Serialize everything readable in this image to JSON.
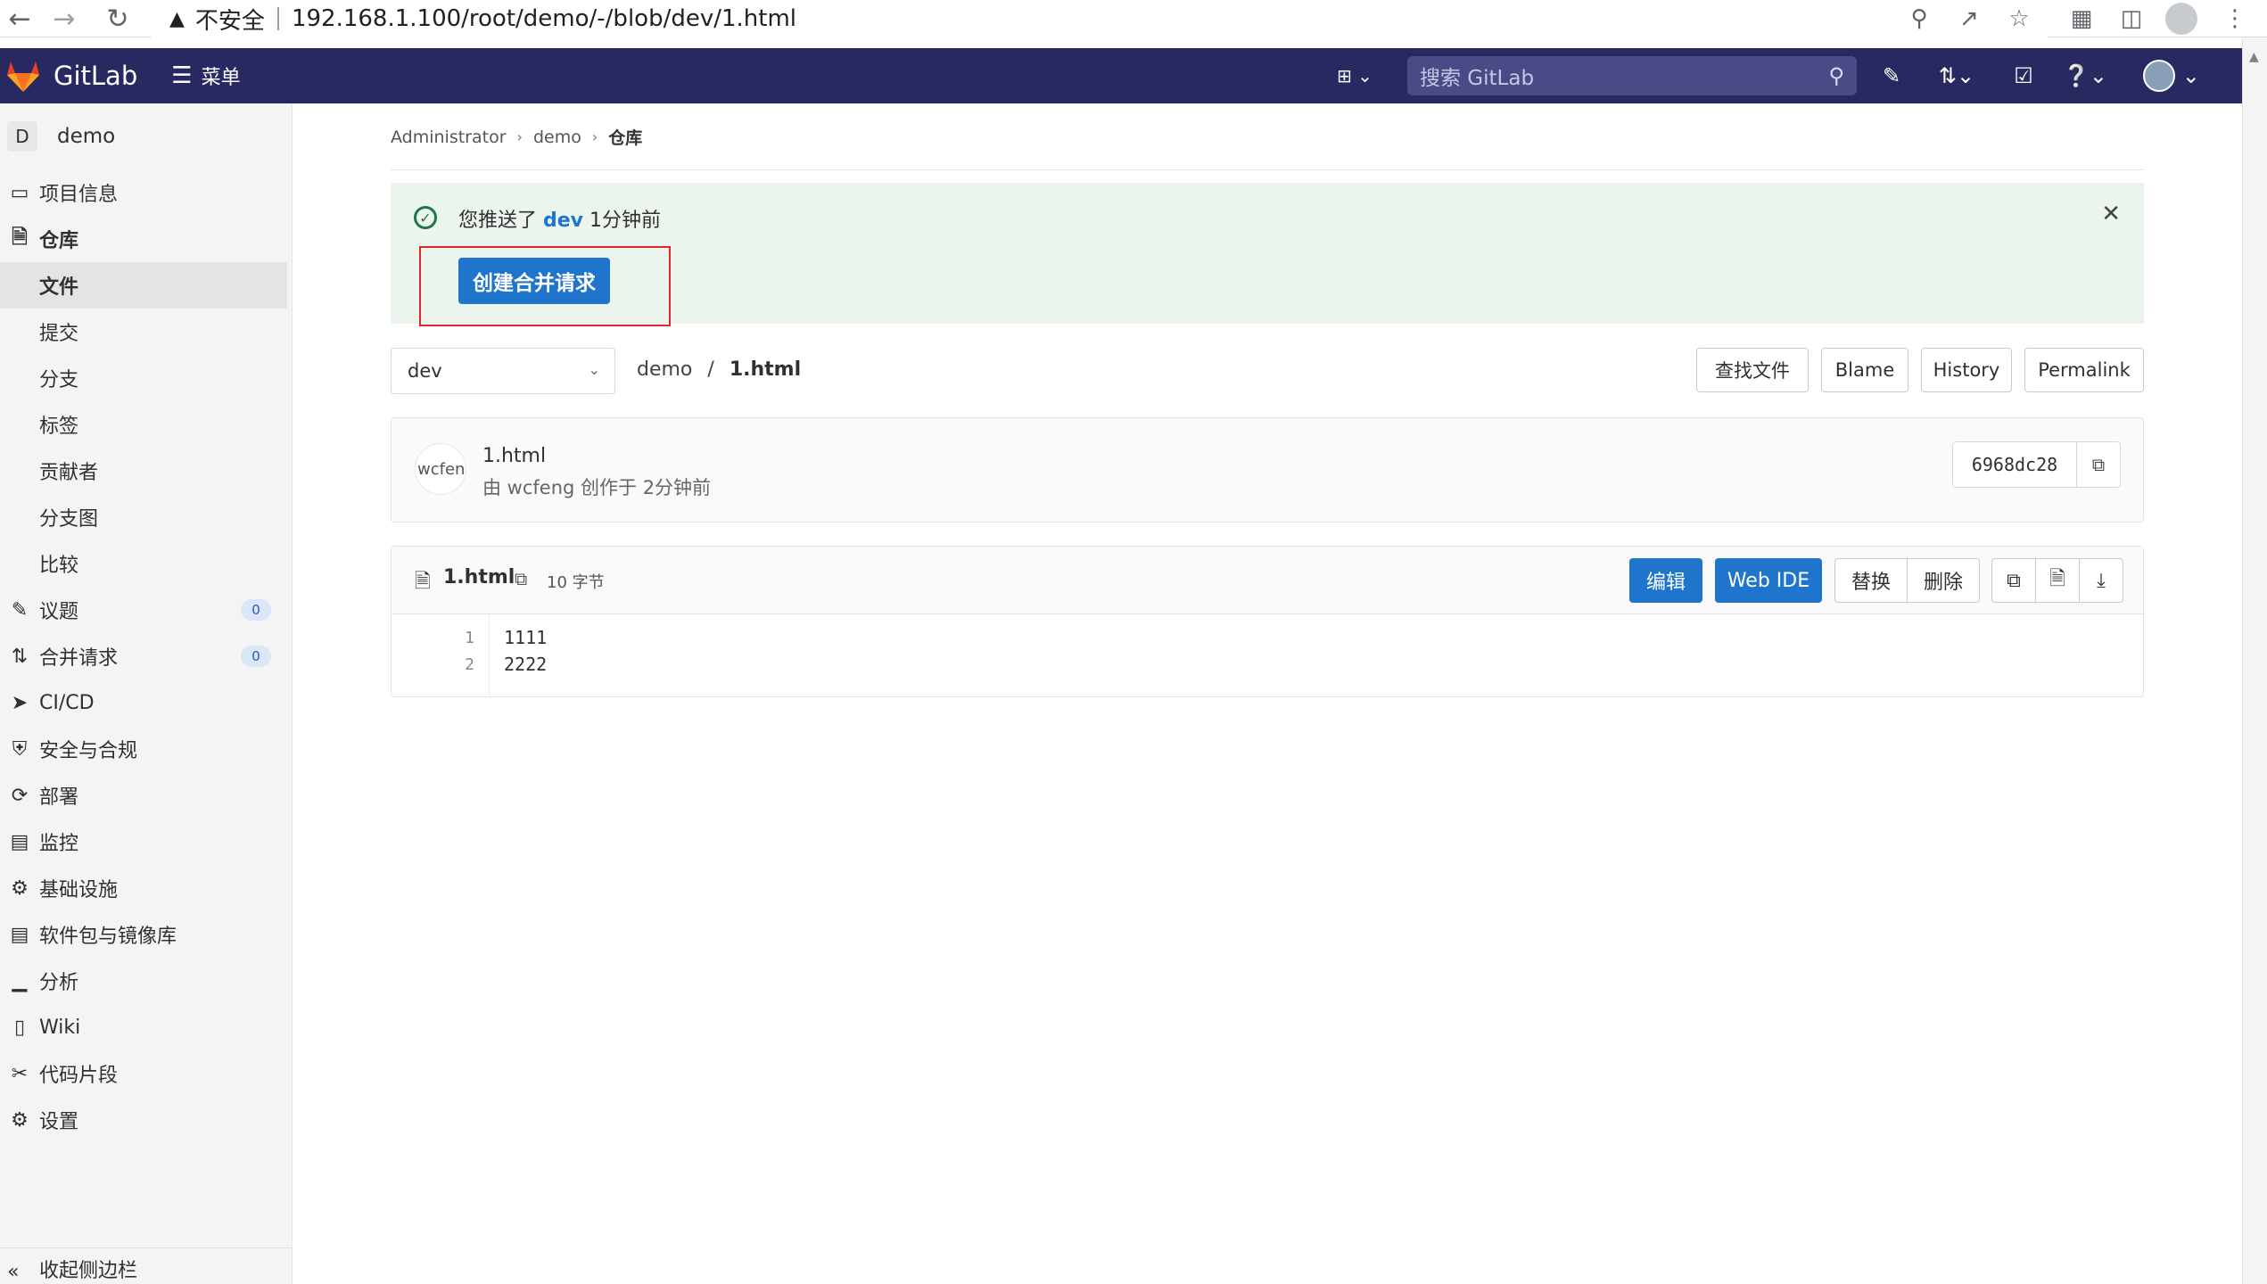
{
  "browser": {
    "security_label": "不安全",
    "url": "192.168.1.100/root/demo/-/blob/dev/1.html"
  },
  "topnav": {
    "app_name": "GitLab",
    "menu_label": "菜单",
    "search_placeholder": "搜索 GitLab"
  },
  "sidebar": {
    "project_initial": "D",
    "project_name": "demo",
    "items": [
      {
        "label": "项目信息",
        "icon": "info-icon"
      },
      {
        "label": "仓库",
        "icon": "repository-icon"
      },
      {
        "label": "文件"
      },
      {
        "label": "提交"
      },
      {
        "label": "分支"
      },
      {
        "label": "标签"
      },
      {
        "label": "贡献者"
      },
      {
        "label": "分支图"
      },
      {
        "label": "比较"
      },
      {
        "label": "议题",
        "icon": "issues-icon",
        "badge": "0"
      },
      {
        "label": "合并请求",
        "icon": "merge-request-icon",
        "badge": "0"
      },
      {
        "label": "CI/CD",
        "icon": "rocket-icon"
      },
      {
        "label": "安全与合规",
        "icon": "shield-icon"
      },
      {
        "label": "部署",
        "icon": "deployments-icon"
      },
      {
        "label": "监控",
        "icon": "monitor-icon"
      },
      {
        "label": "基础设施",
        "icon": "cloud-gear-icon"
      },
      {
        "label": "软件包与镜像库",
        "icon": "package-icon"
      },
      {
        "label": "分析",
        "icon": "chart-icon"
      },
      {
        "label": "Wiki",
        "icon": "book-icon"
      },
      {
        "label": "代码片段",
        "icon": "snippet-icon"
      },
      {
        "label": "设置",
        "icon": "gear-icon"
      }
    ],
    "collapse_label": "收起侧边栏"
  },
  "breadcrumb": {
    "items": [
      "Administrator",
      "demo",
      "仓库"
    ]
  },
  "alert": {
    "prefix": "您推送了",
    "branch": "dev",
    "time": "1分钟前",
    "button_label": "创建合并请求"
  },
  "file_nav": {
    "branch": "dev",
    "path_root": "demo",
    "path_sep": "/",
    "file_name": "1.html",
    "buttons": {
      "find_file": "查找文件",
      "blame": "Blame",
      "history": "History",
      "permalink": "Permalink"
    }
  },
  "commit": {
    "avatar_alt": "wcfeng",
    "title": "1.html",
    "meta": "由 wcfeng 创作于 2分钟前",
    "sha": "6968dc28"
  },
  "file": {
    "name": "1.html",
    "size": "10 字节",
    "buttons": {
      "edit": "编辑",
      "web_ide": "Web IDE",
      "replace": "替换",
      "delete": "删除"
    },
    "lines": [
      {
        "number": "1",
        "text": "1111"
      },
      {
        "number": "2",
        "text": "2222"
      }
    ]
  },
  "colors": {
    "nav_bg": "#292961",
    "primary": "#1f75cb",
    "alert_bg": "#ecf4ee",
    "success": "#217645",
    "highlight_box": "#e0272b"
  }
}
